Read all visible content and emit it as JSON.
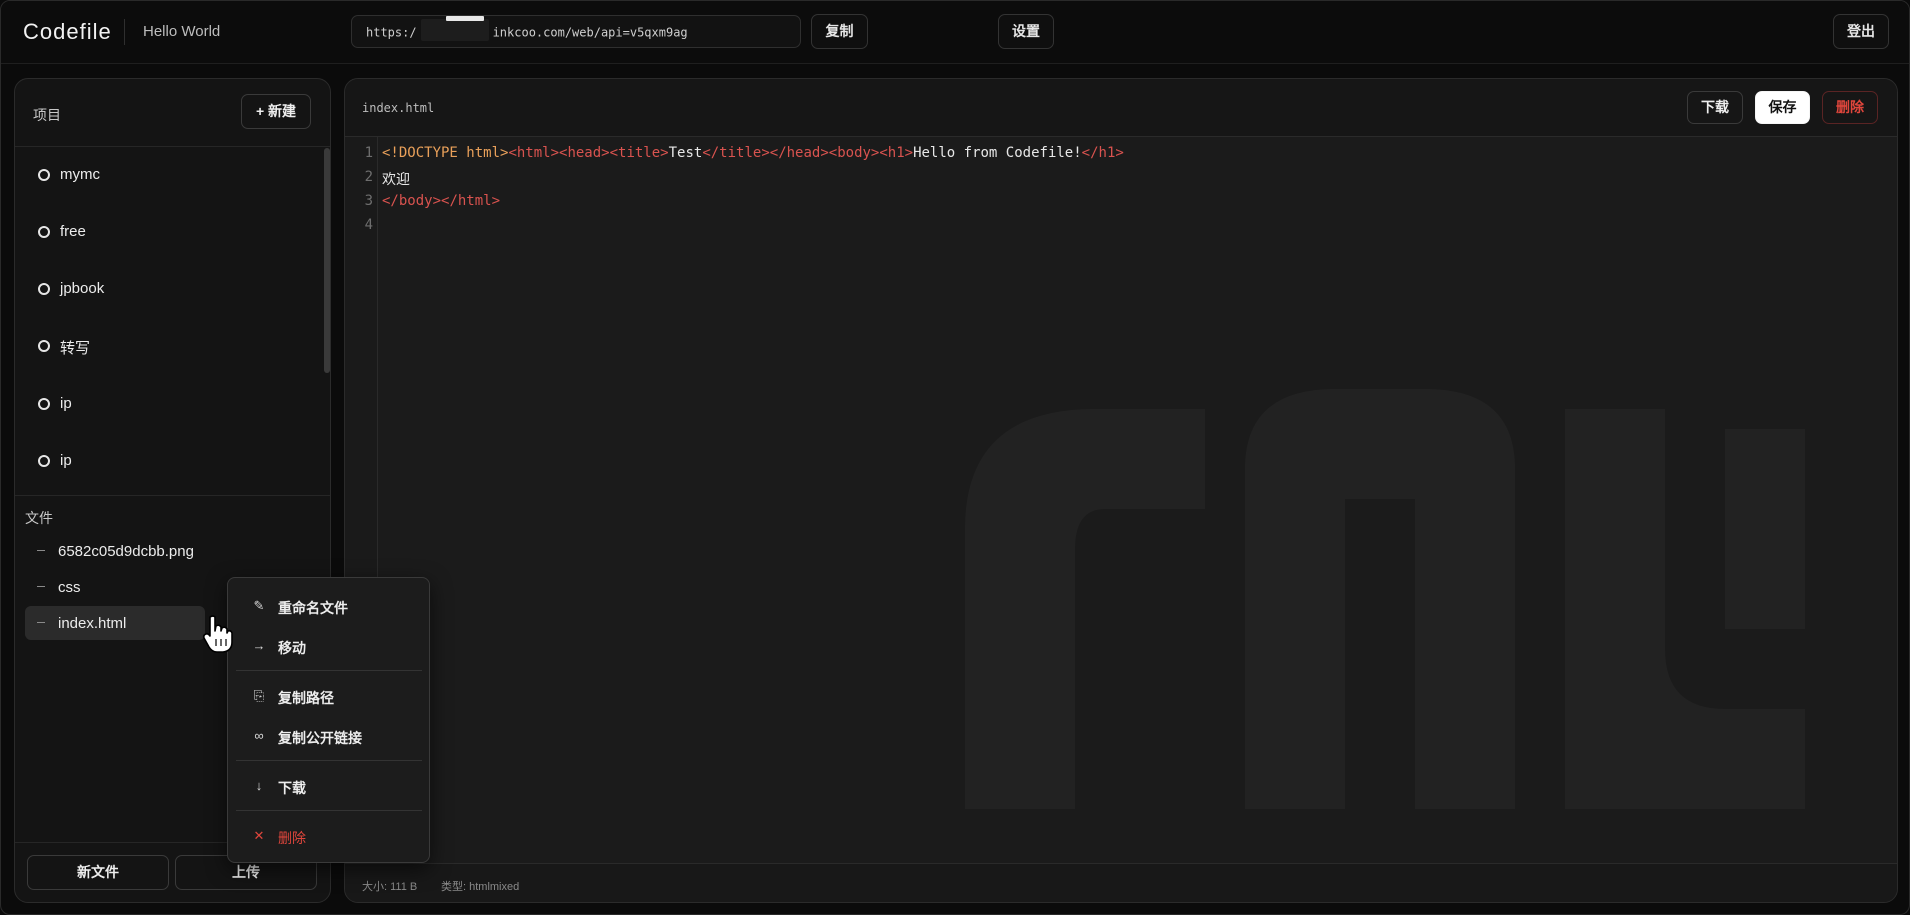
{
  "header": {
    "brand": "Codefile",
    "subtitle": "Hello World",
    "url_prefix": "https:/",
    "url_suffix": "inkcoo.com/web/api=v5qxm9ag",
    "copy_label": "复制",
    "settings_label": "设置",
    "logout_label": "登出"
  },
  "sidebar": {
    "title": "项目",
    "new_label": "+ 新建",
    "projects": [
      "mymc",
      "free",
      "jpbook",
      "转写",
      "ip",
      "ip"
    ],
    "files_title": "文件",
    "files": [
      "6582c05d9dcbb.png",
      "css",
      "index.html"
    ],
    "active_file": "index.html",
    "new_file_label": "新文件",
    "upload_label": "上传"
  },
  "editor": {
    "filename": "index.html",
    "download_label": "下载",
    "save_label": "保存",
    "delete_label": "删除",
    "line_numbers": [
      "1",
      "2",
      "3",
      "4"
    ],
    "lines": [
      [
        "<!DOCTYPE html>",
        "<html>",
        "<head>",
        "<title>",
        "Test",
        "</title>",
        "</head>",
        "<body>",
        "<h1>",
        "Hello from Codefile!",
        "</h1>"
      ],
      [
        "欢迎"
      ],
      [
        "</body>",
        "</html>"
      ],
      []
    ],
    "status_size": "大小: 111 B",
    "status_type": "类型: htmlmixed"
  },
  "context_menu": {
    "items": [
      {
        "icon": "pencil-icon",
        "label": "重命名文件"
      },
      {
        "icon": "arrow-right-icon",
        "label": "移动"
      },
      {
        "icon": "clipboard-icon",
        "label": "复制路径"
      },
      {
        "icon": "link-icon",
        "label": "复制公开链接"
      },
      {
        "icon": "download-icon",
        "label": "下载"
      },
      {
        "icon": "close-icon",
        "label": "删除"
      }
    ]
  },
  "colors": {
    "accent_danger": "#e0463c",
    "tag": "#d9534f",
    "doctype": "#e9a05a"
  }
}
